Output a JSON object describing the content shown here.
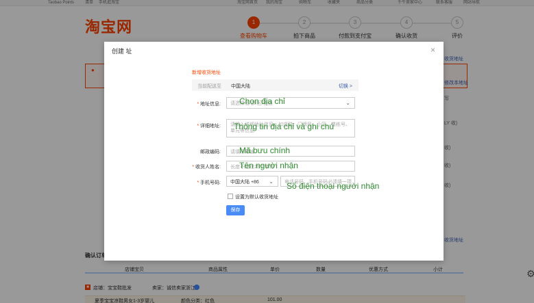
{
  "topbar": {
    "items": [
      "Taobao Points",
      "淘宝网首页",
      "我的淘宝",
      "购物车",
      "收藏夹",
      "商品分类",
      "千牛卖家中心",
      "联系客服",
      "网站导航"
    ],
    "left": [
      "清单",
      "手机逛淘宝"
    ]
  },
  "brand": {
    "logo_text": "淘宝网"
  },
  "steps": [
    {
      "num": "1",
      "label": "查看购物车",
      "active": true
    },
    {
      "num": "2",
      "label": "拍下商品",
      "active": false
    },
    {
      "num": "3",
      "label": "付款到支付宝",
      "active": false
    },
    {
      "num": "4",
      "label": "确认收货",
      "active": false
    },
    {
      "num": "5",
      "label": "评价",
      "active": false
    }
  ],
  "side": {
    "manage_link": "收货地址",
    "edit_link": "修改本地址",
    "texts": [
      "写",
      "LY 收)",
      "收)",
      "收)",
      "收)"
    ],
    "show_link": "收货地址"
  },
  "order": {
    "confirm_title": "确认订单",
    "columns": [
      "店铺宝贝",
      "商品属性",
      "单价",
      "数量",
      "优惠方式",
      "小计"
    ],
    "shop_label": "店铺：宝宝鞋批发",
    "seller_label": "卖家：诚信卖家浙江",
    "item_name": "夏季宝宝凉鞋男女1-3岁婴儿",
    "item_attr": "颜色分类：红色",
    "item_price": "101.00"
  },
  "modal": {
    "title": "创建 址",
    "close": "×",
    "new_address": "新增收货地址",
    "region_label": "当前配送至",
    "region_value": "中国大陆",
    "switch_link": "切换 >",
    "fields": {
      "address_label": "地址信息:",
      "address_placeholder": "请选择省/市/区/街道",
      "detail_label": "详细地址:",
      "detail_placeholder": "请输入详细地址信息，如道路、门牌号、小区、楼栋号、单元等信息",
      "postcode_label": "邮政编码:",
      "postcode_placeholder": "请填写邮编",
      "name_label": "收货人姓名:",
      "name_placeholder": "长度不超过25个字符",
      "phone_label": "手机号码:",
      "phone_country": "中国大陆 +86",
      "phone_placeholder": "电话号码、手机号码必须填一项"
    },
    "default_checkbox_label": "设置为默认收货地址",
    "save_button": "保存"
  },
  "notes": {
    "address": "Chọn địa chỉ",
    "detail": "Thông tin địa chỉ và ghi chú",
    "postcode": "Mã bưu chính",
    "name": "Tên người nhận",
    "phone": "Số điện thoại người nhận"
  },
  "colors": {
    "brand": "#ff4400",
    "note": "#2e8b2e",
    "save": "#4a8cf6",
    "link": "#3c5fb0"
  }
}
